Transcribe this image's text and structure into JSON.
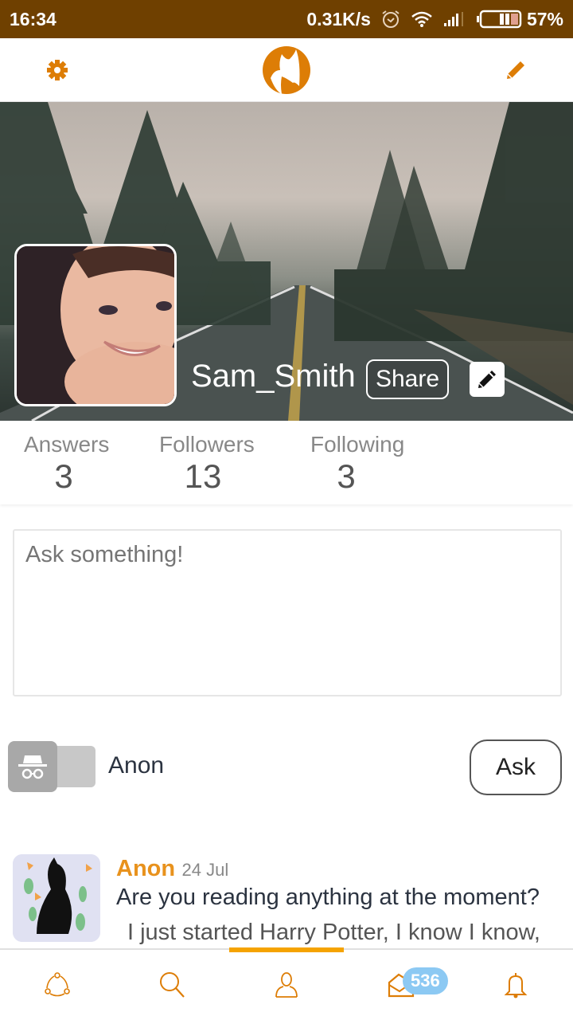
{
  "status_bar": {
    "time": "16:34",
    "network_speed": "0.31K/s",
    "battery_percent": "57%",
    "icons": [
      "alarm-icon",
      "wifi-icon",
      "signal-icon",
      "battery-icon"
    ]
  },
  "header": {
    "left_icon": "gear-icon",
    "logo": "fox-logo",
    "right_icon": "pencil-icon",
    "accent_color": "#dd7d06"
  },
  "profile": {
    "username": "Sam_Smith",
    "share_label": "Share",
    "edit_icon": "pencil-icon"
  },
  "stats": [
    {
      "label": "Answers",
      "value": "3"
    },
    {
      "label": "Followers",
      "value": "13"
    },
    {
      "label": "Following",
      "value": "3"
    }
  ],
  "ask": {
    "placeholder": "Ask something!",
    "value": "",
    "anon_label": "Anon",
    "anon_enabled": false,
    "ask_button": "Ask"
  },
  "feed": [
    {
      "author": "Anon",
      "date": "24 Jul",
      "question": "Are you reading anything at the moment?",
      "answer": "I just started Harry Potter, I know I know,"
    }
  ],
  "bottom_nav": {
    "items": [
      {
        "name": "feed",
        "icon": "share-network-icon"
      },
      {
        "name": "search",
        "icon": "search-icon"
      },
      {
        "name": "profile",
        "icon": "user-icon",
        "active": true
      },
      {
        "name": "inbox",
        "icon": "inbox-icon",
        "badge": "536"
      },
      {
        "name": "notifications",
        "icon": "bell-icon"
      }
    ],
    "active_color": "#f5a300",
    "badge_color": "#8cc9f3"
  }
}
